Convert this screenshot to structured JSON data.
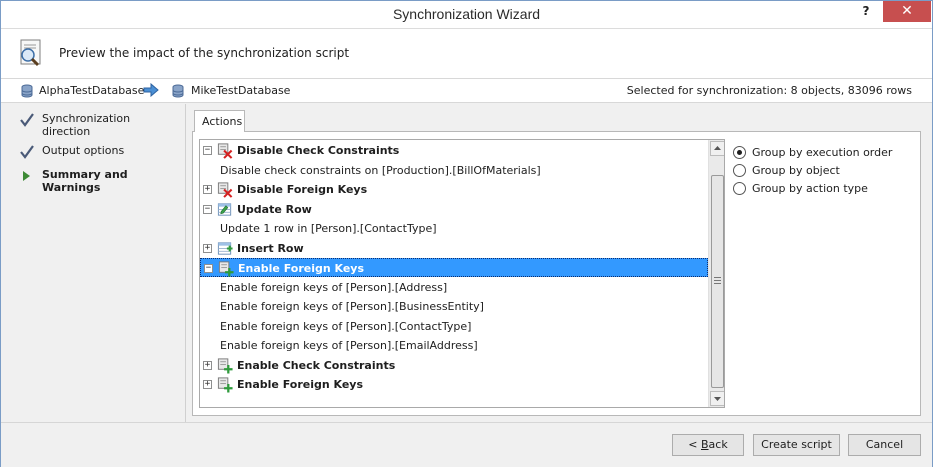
{
  "window": {
    "title": "Synchronization Wizard",
    "help_label": "?",
    "close_label": "✕"
  },
  "header": {
    "text": "Preview the impact of the synchronization script",
    "icon": "preview-document-icon"
  },
  "db": {
    "source": "AlphaTestDatabase",
    "target": "MikeTestDatabase",
    "selected": "Selected for synchronization: 8 objects, 83096 rows"
  },
  "steps": [
    {
      "label": "Synchronization direction",
      "state": "done"
    },
    {
      "label": "Output options",
      "state": "done"
    },
    {
      "label": "Summary and Warnings",
      "state": "current"
    }
  ],
  "tab": {
    "label": "Actions"
  },
  "tree": [
    {
      "type": "group",
      "expander": "−",
      "icon": "disable-constraint-icon",
      "label": "Disable Check Constraints"
    },
    {
      "type": "child",
      "label": "Disable check constraints on [Production].[BillOfMaterials]"
    },
    {
      "type": "group",
      "expander": "+",
      "icon": "disable-constraint-icon",
      "label": "Disable Foreign Keys"
    },
    {
      "type": "group",
      "expander": "−",
      "icon": "update-row-icon",
      "label": "Update Row"
    },
    {
      "type": "child",
      "label": "Update 1 row in [Person].[ContactType]"
    },
    {
      "type": "group",
      "expander": "+",
      "icon": "insert-row-icon",
      "label": "Insert Row"
    },
    {
      "type": "group",
      "expander": "−",
      "icon": "enable-constraint-icon",
      "label": "Enable Foreign Keys",
      "selected": true
    },
    {
      "type": "child",
      "label": "Enable foreign keys of [Person].[Address]"
    },
    {
      "type": "child",
      "label": "Enable foreign keys of [Person].[BusinessEntity]"
    },
    {
      "type": "child",
      "label": "Enable foreign keys of [Person].[ContactType]"
    },
    {
      "type": "child",
      "label": "Enable foreign keys of [Person].[EmailAddress]"
    },
    {
      "type": "group",
      "expander": "+",
      "icon": "enable-constraint-icon",
      "label": "Enable Check Constraints"
    },
    {
      "type": "group",
      "expander": "+",
      "icon": "enable-constraint-icon",
      "label": "Enable Foreign Keys"
    }
  ],
  "grouping": {
    "options": [
      {
        "label": "Group by execution order",
        "checked": true
      },
      {
        "label": "Group by object",
        "checked": false
      },
      {
        "label": "Group by action type",
        "checked": false
      }
    ]
  },
  "footer": {
    "back_prefix": "< ",
    "back_mnemonic": "B",
    "back_rest": "ack",
    "create_label": "Create script",
    "cancel_label": "Cancel"
  },
  "colors": {
    "selection": "#3399ff",
    "close": "#c74f4f",
    "check": "#4a5a78",
    "arrow": "#3d8a35"
  }
}
